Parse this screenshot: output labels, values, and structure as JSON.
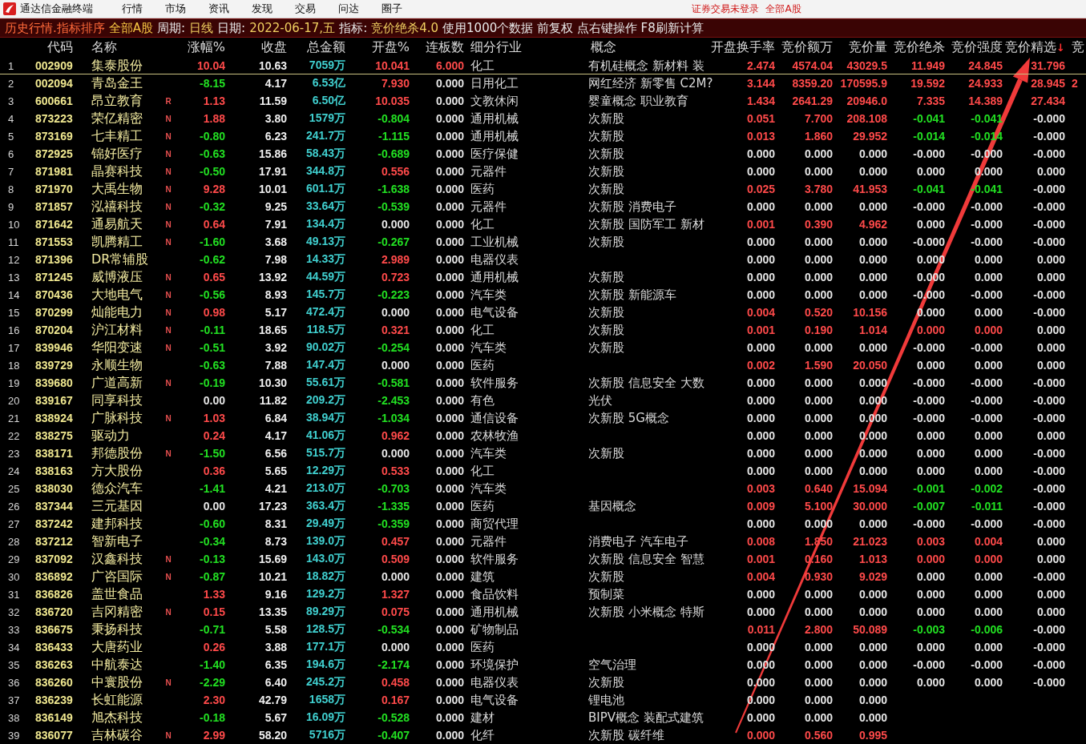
{
  "window": {
    "title": "通达信金融终端"
  },
  "menu": [
    "行情",
    "市场",
    "资讯",
    "发现",
    "交易",
    "问达",
    "圈子"
  ],
  "status": [
    "证券交易未登录",
    "全部A股"
  ],
  "info_bar": [
    {
      "kind": "title",
      "text": "历史行情.指标排序"
    },
    {
      "kind": "market",
      "text": "全部A股"
    },
    {
      "kind": "label",
      "text": "周期:"
    },
    {
      "kind": "value",
      "text": "日线"
    },
    {
      "kind": "label",
      "text": "日期:"
    },
    {
      "kind": "value",
      "text": "2022-06-17,五"
    },
    {
      "kind": "label",
      "text": "指标:"
    },
    {
      "kind": "value",
      "text": "竞价绝杀4.0"
    },
    {
      "kind": "label",
      "text": "使用1000个数据 前复权 点右键操作 F8刷新计算"
    }
  ],
  "table": {
    "columns": [
      {
        "kind": "index"
      },
      {
        "kind": "code",
        "label": "代码"
      },
      {
        "kind": "name",
        "label": "名称"
      },
      {
        "kind": "flag"
      },
      {
        "kind": "signed",
        "label": "涨幅%"
      },
      {
        "kind": "price",
        "label": "收盘"
      },
      {
        "kind": "amount",
        "label": "总金额"
      },
      {
        "kind": "signed",
        "label": "开盘%"
      },
      {
        "kind": "signed",
        "label": "连板数"
      },
      {
        "kind": "industry",
        "label": "细分行业"
      },
      {
        "kind": "concept",
        "label": "概念"
      },
      {
        "kind": "signed",
        "label": "开盘换手率"
      },
      {
        "kind": "signed",
        "label": "竞价额万"
      },
      {
        "kind": "signed",
        "label": "竞价量"
      },
      {
        "kind": "signed",
        "label": "竞价绝杀"
      },
      {
        "kind": "signed",
        "label": "竞价强度"
      },
      {
        "kind": "signed",
        "label": "竞价精选",
        "sort_mark": "↓"
      },
      {
        "kind": "cut",
        "label": "竞"
      }
    ],
    "rows": [
      {
        "selected": true,
        "cells": [
          "1",
          "002909",
          "集泰股份",
          null,
          {
            "text": "10.04",
            "color": "#ff4a4a"
          },
          "10.63",
          "7059万",
          {
            "text": "10.041",
            "color": "#ff4a4a"
          },
          {
            "text": "6.000",
            "color": "#ff4a4a"
          },
          "化工",
          "有机硅概念 新材料 装",
          {
            "text": "2.474",
            "color": "#ff4a4a"
          },
          {
            "text": "4574.04",
            "color": "#ff4a4a"
          },
          {
            "text": "43029.5",
            "color": "#ff4a4a"
          },
          {
            "text": "11.949",
            "color": "#ff4a4a"
          },
          {
            "text": "24.845",
            "color": "#ff4a4a"
          },
          {
            "text": "31.796",
            "color": "#ff4a4a"
          }
        ]
      },
      {
        "selected": false,
        "cells": [
          "2",
          "002094",
          "青岛金王",
          null,
          {
            "text": "-8.15",
            "color": "#22e022"
          },
          "4.17",
          "6.53亿",
          {
            "text": "7.930",
            "color": "#ff4a4a"
          },
          {
            "text": "0.000",
            "color": "#e6e6e6"
          },
          "日用化工",
          "网红经济 新零售 C2M?",
          {
            "text": "3.144",
            "color": "#ff4a4a"
          },
          {
            "text": "8359.20",
            "color": "#ff4a4a"
          },
          {
            "text": "170595.9",
            "color": "#ff4a4a"
          },
          {
            "text": "19.592",
            "color": "#ff4a4a"
          },
          {
            "text": "24.933",
            "color": "#ff4a4a"
          },
          {
            "text": "28.945",
            "color": "#ff4a4a"
          },
          "2"
        ]
      },
      {
        "selected": false,
        "cells": [
          "3",
          "600661",
          "昂立教育",
          "R",
          {
            "text": "1.13",
            "color": "#ff4a4a"
          },
          "11.59",
          "6.50亿",
          {
            "text": "10.035",
            "color": "#ff4a4a"
          },
          {
            "text": "0.000",
            "color": "#e6e6e6"
          },
          "文教休闲",
          "婴童概念 职业教育",
          {
            "text": "1.434",
            "color": "#ff4a4a"
          },
          {
            "text": "2641.29",
            "color": "#ff4a4a"
          },
          {
            "text": "20946.0",
            "color": "#ff4a4a"
          },
          {
            "text": "7.335",
            "color": "#ff4a4a"
          },
          {
            "text": "14.389",
            "color": "#ff4a4a"
          },
          {
            "text": "27.434",
            "color": "#ff4a4a"
          }
        ]
      },
      {
        "selected": false,
        "cells": [
          "4",
          "873223",
          "荣亿精密",
          "N",
          {
            "text": "1.88",
            "color": "#ff4a4a"
          },
          "3.80",
          "1579万",
          {
            "text": "-0.804",
            "color": "#22e022"
          },
          {
            "text": "0.000",
            "color": "#e6e6e6"
          },
          "通用机械",
          "次新股",
          {
            "text": "0.051",
            "color": "#ff4a4a"
          },
          {
            "text": "7.700",
            "color": "#ff4a4a"
          },
          {
            "text": "208.108",
            "color": "#ff4a4a"
          },
          {
            "text": "-0.041",
            "color": "#22e022"
          },
          {
            "text": "-0.041",
            "color": "#22e022"
          },
          {
            "text": "-0.000",
            "color": "#e6e6e6"
          }
        ]
      },
      {
        "selected": false,
        "cells": [
          "5",
          "873169",
          "七丰精工",
          "N",
          {
            "text": "-0.80",
            "color": "#22e022"
          },
          "6.23",
          "241.7万",
          {
            "text": "-1.115",
            "color": "#22e022"
          },
          {
            "text": "0.000",
            "color": "#e6e6e6"
          },
          "通用机械",
          "次新股",
          {
            "text": "0.013",
            "color": "#ff4a4a"
          },
          {
            "text": "1.860",
            "color": "#ff4a4a"
          },
          {
            "text": "29.952",
            "color": "#ff4a4a"
          },
          {
            "text": "-0.014",
            "color": "#22e022"
          },
          {
            "text": "-0.014",
            "color": "#22e022"
          },
          {
            "text": "-0.000",
            "color": "#e6e6e6"
          }
        ]
      },
      {
        "selected": false,
        "cells": [
          "6",
          "872925",
          "锦好医疗",
          "N",
          {
            "text": "-0.63",
            "color": "#22e022"
          },
          "15.86",
          "58.43万",
          {
            "text": "-0.689",
            "color": "#22e022"
          },
          {
            "text": "0.000",
            "color": "#e6e6e6"
          },
          "医疗保健",
          "次新股",
          {
            "text": "0.000",
            "color": "#e6e6e6"
          },
          {
            "text": "0.000",
            "color": "#e6e6e6"
          },
          {
            "text": "0.000",
            "color": "#e6e6e6"
          },
          {
            "text": "-0.000",
            "color": "#e6e6e6"
          },
          {
            "text": "-0.000",
            "color": "#e6e6e6"
          },
          {
            "text": "-0.000",
            "color": "#e6e6e6"
          }
        ]
      },
      {
        "selected": false,
        "cells": [
          "7",
          "871981",
          "晶赛科技",
          "N",
          {
            "text": "-0.50",
            "color": "#22e022"
          },
          "17.91",
          "344.8万",
          {
            "text": "0.556",
            "color": "#ff4a4a"
          },
          {
            "text": "0.000",
            "color": "#e6e6e6"
          },
          "元器件",
          "次新股",
          {
            "text": "0.000",
            "color": "#e6e6e6"
          },
          {
            "text": "0.000",
            "color": "#e6e6e6"
          },
          {
            "text": "0.000",
            "color": "#e6e6e6"
          },
          {
            "text": "0.000",
            "color": "#e6e6e6"
          },
          {
            "text": "0.000",
            "color": "#e6e6e6"
          },
          {
            "text": "0.000",
            "color": "#e6e6e6"
          }
        ]
      },
      {
        "selected": false,
        "cells": [
          "8",
          "871970",
          "大禹生物",
          "N",
          {
            "text": "9.28",
            "color": "#ff4a4a"
          },
          "10.01",
          "601.1万",
          {
            "text": "-1.638",
            "color": "#22e022"
          },
          {
            "text": "0.000",
            "color": "#e6e6e6"
          },
          "医药",
          "次新股",
          {
            "text": "0.025",
            "color": "#ff4a4a"
          },
          {
            "text": "3.780",
            "color": "#ff4a4a"
          },
          {
            "text": "41.953",
            "color": "#ff4a4a"
          },
          {
            "text": "-0.041",
            "color": "#22e022"
          },
          {
            "text": "-0.041",
            "color": "#22e022"
          },
          {
            "text": "-0.000",
            "color": "#e6e6e6"
          }
        ]
      },
      {
        "selected": false,
        "cells": [
          "9",
          "871857",
          "泓禧科技",
          "N",
          {
            "text": "-0.32",
            "color": "#22e022"
          },
          "9.25",
          "33.64万",
          {
            "text": "-0.539",
            "color": "#22e022"
          },
          {
            "text": "0.000",
            "color": "#e6e6e6"
          },
          "元器件",
          "次新股 消费电子",
          {
            "text": "0.000",
            "color": "#e6e6e6"
          },
          {
            "text": "0.000",
            "color": "#e6e6e6"
          },
          {
            "text": "0.000",
            "color": "#e6e6e6"
          },
          {
            "text": "-0.000",
            "color": "#e6e6e6"
          },
          {
            "text": "-0.000",
            "color": "#e6e6e6"
          },
          {
            "text": "-0.000",
            "color": "#e6e6e6"
          }
        ]
      },
      {
        "selected": false,
        "cells": [
          "10",
          "871642",
          "通易航天",
          "N",
          {
            "text": "0.64",
            "color": "#ff4a4a"
          },
          "7.91",
          "134.4万",
          {
            "text": "0.000",
            "color": "#e6e6e6"
          },
          {
            "text": "0.000",
            "color": "#e6e6e6"
          },
          "化工",
          "次新股 国防军工 新材",
          {
            "text": "0.001",
            "color": "#ff4a4a"
          },
          {
            "text": "0.390",
            "color": "#ff4a4a"
          },
          {
            "text": "4.962",
            "color": "#ff4a4a"
          },
          {
            "text": "0.000",
            "color": "#e6e6e6"
          },
          {
            "text": "-0.000",
            "color": "#e6e6e6"
          },
          {
            "text": "-0.000",
            "color": "#e6e6e6"
          }
        ]
      },
      {
        "selected": false,
        "cells": [
          "11",
          "871553",
          "凯腾精工",
          "N",
          {
            "text": "-1.60",
            "color": "#22e022"
          },
          "3.68",
          "49.13万",
          {
            "text": "-0.267",
            "color": "#22e022"
          },
          {
            "text": "0.000",
            "color": "#e6e6e6"
          },
          "工业机械",
          "次新股",
          {
            "text": "0.000",
            "color": "#e6e6e6"
          },
          {
            "text": "0.000",
            "color": "#e6e6e6"
          },
          {
            "text": "0.000",
            "color": "#e6e6e6"
          },
          {
            "text": "-0.000",
            "color": "#e6e6e6"
          },
          {
            "text": "-0.000",
            "color": "#e6e6e6"
          },
          {
            "text": "-0.000",
            "color": "#e6e6e6"
          }
        ]
      },
      {
        "selected": false,
        "cells": [
          "12",
          "871396",
          "DR常辅股",
          null,
          {
            "text": "-0.62",
            "color": "#22e022"
          },
          "7.98",
          "14.33万",
          {
            "text": "2.989",
            "color": "#ff4a4a"
          },
          {
            "text": "0.000",
            "color": "#e6e6e6"
          },
          "电器仪表",
          null,
          {
            "text": "0.000",
            "color": "#e6e6e6"
          },
          {
            "text": "0.000",
            "color": "#e6e6e6"
          },
          {
            "text": "0.000",
            "color": "#e6e6e6"
          },
          {
            "text": "0.000",
            "color": "#e6e6e6"
          },
          {
            "text": "0.000",
            "color": "#e6e6e6"
          },
          {
            "text": "0.000",
            "color": "#e6e6e6"
          }
        ]
      },
      {
        "selected": false,
        "cells": [
          "13",
          "871245",
          "威博液压",
          "N",
          {
            "text": "0.65",
            "color": "#ff4a4a"
          },
          "13.92",
          "44.59万",
          {
            "text": "0.723",
            "color": "#ff4a4a"
          },
          {
            "text": "0.000",
            "color": "#e6e6e6"
          },
          "通用机械",
          "次新股",
          {
            "text": "0.000",
            "color": "#e6e6e6"
          },
          {
            "text": "0.000",
            "color": "#e6e6e6"
          },
          {
            "text": "0.000",
            "color": "#e6e6e6"
          },
          {
            "text": "0.000",
            "color": "#e6e6e6"
          },
          {
            "text": "0.000",
            "color": "#e6e6e6"
          },
          {
            "text": "0.000",
            "color": "#e6e6e6"
          }
        ]
      },
      {
        "selected": false,
        "cells": [
          "14",
          "870436",
          "大地电气",
          "N",
          {
            "text": "-0.56",
            "color": "#22e022"
          },
          "8.93",
          "145.7万",
          {
            "text": "-0.223",
            "color": "#22e022"
          },
          {
            "text": "0.000",
            "color": "#e6e6e6"
          },
          "汽车类",
          "次新股 新能源车",
          {
            "text": "0.000",
            "color": "#e6e6e6"
          },
          {
            "text": "0.000",
            "color": "#e6e6e6"
          },
          {
            "text": "0.000",
            "color": "#e6e6e6"
          },
          {
            "text": "-0.000",
            "color": "#e6e6e6"
          },
          {
            "text": "-0.000",
            "color": "#e6e6e6"
          },
          {
            "text": "-0.000",
            "color": "#e6e6e6"
          }
        ]
      },
      {
        "selected": false,
        "cells": [
          "15",
          "870299",
          "灿能电力",
          "N",
          {
            "text": "0.98",
            "color": "#ff4a4a"
          },
          "5.17",
          "472.4万",
          {
            "text": "0.000",
            "color": "#e6e6e6"
          },
          {
            "text": "0.000",
            "color": "#e6e6e6"
          },
          "电气设备",
          "次新股",
          {
            "text": "0.004",
            "color": "#ff4a4a"
          },
          {
            "text": "0.520",
            "color": "#ff4a4a"
          },
          {
            "text": "10.156",
            "color": "#ff4a4a"
          },
          {
            "text": "0.000",
            "color": "#e6e6e6"
          },
          {
            "text": "0.000",
            "color": "#e6e6e6"
          },
          {
            "text": "-0.000",
            "color": "#e6e6e6"
          }
        ]
      },
      {
        "selected": false,
        "cells": [
          "16",
          "870204",
          "沪江材料",
          "N",
          {
            "text": "-0.11",
            "color": "#22e022"
          },
          "18.65",
          "118.5万",
          {
            "text": "0.321",
            "color": "#ff4a4a"
          },
          {
            "text": "0.000",
            "color": "#e6e6e6"
          },
          "化工",
          "次新股",
          {
            "text": "0.001",
            "color": "#ff4a4a"
          },
          {
            "text": "0.190",
            "color": "#ff4a4a"
          },
          {
            "text": "1.014",
            "color": "#ff4a4a"
          },
          {
            "text": "0.000",
            "color": "#ff4a4a"
          },
          {
            "text": "0.000",
            "color": "#ff4a4a"
          },
          {
            "text": "0.000",
            "color": "#e6e6e6"
          }
        ]
      },
      {
        "selected": false,
        "cells": [
          "17",
          "839946",
          "华阳变速",
          "N",
          {
            "text": "-0.51",
            "color": "#22e022"
          },
          "3.92",
          "90.02万",
          {
            "text": "-0.254",
            "color": "#22e022"
          },
          {
            "text": "0.000",
            "color": "#e6e6e6"
          },
          "汽车类",
          "次新股",
          {
            "text": "0.000",
            "color": "#e6e6e6"
          },
          {
            "text": "0.000",
            "color": "#e6e6e6"
          },
          {
            "text": "0.000",
            "color": "#e6e6e6"
          },
          {
            "text": "-0.000",
            "color": "#e6e6e6"
          },
          {
            "text": "-0.000",
            "color": "#e6e6e6"
          },
          {
            "text": "0.000",
            "color": "#e6e6e6"
          }
        ]
      },
      {
        "selected": false,
        "cells": [
          "18",
          "839729",
          "永顺生物",
          null,
          {
            "text": "-0.63",
            "color": "#22e022"
          },
          "7.88",
          "147.4万",
          {
            "text": "0.000",
            "color": "#e6e6e6"
          },
          {
            "text": "0.000",
            "color": "#e6e6e6"
          },
          "医药",
          null,
          {
            "text": "0.002",
            "color": "#ff4a4a"
          },
          {
            "text": "1.590",
            "color": "#ff4a4a"
          },
          {
            "text": "20.050",
            "color": "#ff4a4a"
          },
          {
            "text": "0.000",
            "color": "#e6e6e6"
          },
          {
            "text": "0.000",
            "color": "#e6e6e6"
          },
          {
            "text": "0.000",
            "color": "#e6e6e6"
          }
        ]
      },
      {
        "selected": false,
        "cells": [
          "19",
          "839680",
          "广道高新",
          "N",
          {
            "text": "-0.19",
            "color": "#22e022"
          },
          "10.30",
          "55.61万",
          {
            "text": "-0.581",
            "color": "#22e022"
          },
          {
            "text": "0.000",
            "color": "#e6e6e6"
          },
          "软件服务",
          "次新股 信息安全 大数",
          {
            "text": "0.000",
            "color": "#e6e6e6"
          },
          {
            "text": "0.000",
            "color": "#e6e6e6"
          },
          {
            "text": "0.000",
            "color": "#e6e6e6"
          },
          {
            "text": "-0.000",
            "color": "#e6e6e6"
          },
          {
            "text": "-0.000",
            "color": "#e6e6e6"
          },
          {
            "text": "-0.000",
            "color": "#e6e6e6"
          }
        ]
      },
      {
        "selected": false,
        "cells": [
          "20",
          "839167",
          "同享科技",
          null,
          {
            "text": "0.00",
            "color": "#e6e6e6"
          },
          "11.82",
          "209.2万",
          {
            "text": "-2.453",
            "color": "#22e022"
          },
          {
            "text": "0.000",
            "color": "#e6e6e6"
          },
          "有色",
          "光伏",
          {
            "text": "0.000",
            "color": "#e6e6e6"
          },
          {
            "text": "0.000",
            "color": "#e6e6e6"
          },
          {
            "text": "0.000",
            "color": "#e6e6e6"
          },
          {
            "text": "-0.000",
            "color": "#e6e6e6"
          },
          {
            "text": "-0.000",
            "color": "#e6e6e6"
          },
          {
            "text": "-0.000",
            "color": "#e6e6e6"
          }
        ]
      },
      {
        "selected": false,
        "cells": [
          "21",
          "838924",
          "广脉科技",
          "N",
          {
            "text": "1.03",
            "color": "#ff4a4a"
          },
          "6.84",
          "38.94万",
          {
            "text": "-1.034",
            "color": "#22e022"
          },
          {
            "text": "0.000",
            "color": "#e6e6e6"
          },
          "通信设备",
          "次新股 5G概念",
          {
            "text": "0.000",
            "color": "#e6e6e6"
          },
          {
            "text": "0.000",
            "color": "#e6e6e6"
          },
          {
            "text": "0.000",
            "color": "#e6e6e6"
          },
          {
            "text": "-0.000",
            "color": "#e6e6e6"
          },
          {
            "text": "-0.000",
            "color": "#e6e6e6"
          },
          {
            "text": "-0.000",
            "color": "#e6e6e6"
          }
        ]
      },
      {
        "selected": false,
        "cells": [
          "22",
          "838275",
          "驱动力",
          null,
          {
            "text": "0.24",
            "color": "#ff4a4a"
          },
          "4.17",
          "41.06万",
          {
            "text": "0.962",
            "color": "#ff4a4a"
          },
          {
            "text": "0.000",
            "color": "#e6e6e6"
          },
          "农林牧渔",
          null,
          {
            "text": "0.000",
            "color": "#e6e6e6"
          },
          {
            "text": "0.000",
            "color": "#e6e6e6"
          },
          {
            "text": "0.000",
            "color": "#e6e6e6"
          },
          {
            "text": "0.000",
            "color": "#e6e6e6"
          },
          {
            "text": "0.000",
            "color": "#e6e6e6"
          },
          {
            "text": "0.000",
            "color": "#e6e6e6"
          }
        ]
      },
      {
        "selected": false,
        "cells": [
          "23",
          "838171",
          "邦德股份",
          "N",
          {
            "text": "-1.50",
            "color": "#22e022"
          },
          "6.56",
          "515.7万",
          {
            "text": "0.000",
            "color": "#e6e6e6"
          },
          {
            "text": "0.000",
            "color": "#e6e6e6"
          },
          "汽车类",
          "次新股",
          {
            "text": "0.000",
            "color": "#e6e6e6"
          },
          {
            "text": "0.000",
            "color": "#e6e6e6"
          },
          {
            "text": "0.000",
            "color": "#e6e6e6"
          },
          {
            "text": "0.000",
            "color": "#e6e6e6"
          },
          {
            "text": "0.000",
            "color": "#e6e6e6"
          },
          {
            "text": "-0.000",
            "color": "#e6e6e6"
          }
        ]
      },
      {
        "selected": false,
        "cells": [
          "24",
          "838163",
          "方大股份",
          null,
          {
            "text": "0.36",
            "color": "#ff4a4a"
          },
          "5.65",
          "12.29万",
          {
            "text": "0.533",
            "color": "#ff4a4a"
          },
          {
            "text": "0.000",
            "color": "#e6e6e6"
          },
          "化工",
          null,
          {
            "text": "0.000",
            "color": "#e6e6e6"
          },
          {
            "text": "0.000",
            "color": "#e6e6e6"
          },
          {
            "text": "0.000",
            "color": "#e6e6e6"
          },
          {
            "text": "0.000",
            "color": "#e6e6e6"
          },
          {
            "text": "0.000",
            "color": "#e6e6e6"
          },
          {
            "text": "-0.000",
            "color": "#e6e6e6"
          }
        ]
      },
      {
        "selected": false,
        "cells": [
          "25",
          "838030",
          "德众汽车",
          null,
          {
            "text": "-1.41",
            "color": "#22e022"
          },
          "4.21",
          "213.0万",
          {
            "text": "-0.703",
            "color": "#22e022"
          },
          {
            "text": "0.000",
            "color": "#e6e6e6"
          },
          "汽车类",
          null,
          {
            "text": "0.003",
            "color": "#ff4a4a"
          },
          {
            "text": "0.640",
            "color": "#ff4a4a"
          },
          {
            "text": "15.094",
            "color": "#ff4a4a"
          },
          {
            "text": "-0.001",
            "color": "#22e022"
          },
          {
            "text": "-0.002",
            "color": "#22e022"
          },
          {
            "text": "-0.000",
            "color": "#e6e6e6"
          }
        ]
      },
      {
        "selected": false,
        "cells": [
          "26",
          "837344",
          "三元基因",
          null,
          {
            "text": "0.00",
            "color": "#e6e6e6"
          },
          "17.23",
          "363.4万",
          {
            "text": "-1.335",
            "color": "#22e022"
          },
          {
            "text": "0.000",
            "color": "#e6e6e6"
          },
          "医药",
          "基因概念",
          {
            "text": "0.009",
            "color": "#ff4a4a"
          },
          {
            "text": "5.100",
            "color": "#ff4a4a"
          },
          {
            "text": "30.000",
            "color": "#ff4a4a"
          },
          {
            "text": "-0.007",
            "color": "#22e022"
          },
          {
            "text": "-0.011",
            "color": "#22e022"
          },
          {
            "text": "-0.000",
            "color": "#e6e6e6"
          }
        ]
      },
      {
        "selected": false,
        "cells": [
          "27",
          "837242",
          "建邦科技",
          null,
          {
            "text": "-0.60",
            "color": "#22e022"
          },
          "8.31",
          "29.49万",
          {
            "text": "-0.359",
            "color": "#22e022"
          },
          {
            "text": "0.000",
            "color": "#e6e6e6"
          },
          "商贸代理",
          null,
          {
            "text": "0.000",
            "color": "#e6e6e6"
          },
          {
            "text": "0.000",
            "color": "#e6e6e6"
          },
          {
            "text": "0.000",
            "color": "#e6e6e6"
          },
          {
            "text": "-0.000",
            "color": "#e6e6e6"
          },
          {
            "text": "-0.000",
            "color": "#e6e6e6"
          },
          {
            "text": "-0.000",
            "color": "#e6e6e6"
          }
        ]
      },
      {
        "selected": false,
        "cells": [
          "28",
          "837212",
          "智新电子",
          null,
          {
            "text": "-0.34",
            "color": "#22e022"
          },
          "8.73",
          "139.0万",
          {
            "text": "0.457",
            "color": "#ff4a4a"
          },
          {
            "text": "0.000",
            "color": "#e6e6e6"
          },
          "元器件",
          "消费电子 汽车电子",
          {
            "text": "0.008",
            "color": "#ff4a4a"
          },
          {
            "text": "1.850",
            "color": "#ff4a4a"
          },
          {
            "text": "21.023",
            "color": "#ff4a4a"
          },
          {
            "text": "0.003",
            "color": "#ff4a4a"
          },
          {
            "text": "0.004",
            "color": "#ff4a4a"
          },
          {
            "text": "0.000",
            "color": "#e6e6e6"
          }
        ]
      },
      {
        "selected": false,
        "cells": [
          "29",
          "837092",
          "汉鑫科技",
          "N",
          {
            "text": "-0.13",
            "color": "#22e022"
          },
          "15.69",
          "143.0万",
          {
            "text": "0.509",
            "color": "#ff4a4a"
          },
          {
            "text": "0.000",
            "color": "#e6e6e6"
          },
          "软件服务",
          "次新股 信息安全 智慧",
          {
            "text": "0.001",
            "color": "#ff4a4a"
          },
          {
            "text": "0.160",
            "color": "#ff4a4a"
          },
          {
            "text": "1.013",
            "color": "#ff4a4a"
          },
          {
            "text": "0.000",
            "color": "#ff4a4a"
          },
          {
            "text": "0.000",
            "color": "#ff4a4a"
          },
          {
            "text": "0.000",
            "color": "#e6e6e6"
          }
        ]
      },
      {
        "selected": false,
        "cells": [
          "30",
          "836892",
          "广咨国际",
          "N",
          {
            "text": "-0.87",
            "color": "#22e022"
          },
          "10.21",
          "18.82万",
          {
            "text": "0.000",
            "color": "#e6e6e6"
          },
          {
            "text": "0.000",
            "color": "#e6e6e6"
          },
          "建筑",
          "次新股",
          {
            "text": "0.004",
            "color": "#ff4a4a"
          },
          {
            "text": "0.930",
            "color": "#ff4a4a"
          },
          {
            "text": "9.029",
            "color": "#ff4a4a"
          },
          {
            "text": "0.000",
            "color": "#e6e6e6"
          },
          {
            "text": "0.000",
            "color": "#e6e6e6"
          },
          {
            "text": "-0.000",
            "color": "#e6e6e6"
          }
        ]
      },
      {
        "selected": false,
        "cells": [
          "31",
          "836826",
          "盖世食品",
          null,
          {
            "text": "1.33",
            "color": "#ff4a4a"
          },
          "9.16",
          "129.2万",
          {
            "text": "1.327",
            "color": "#ff4a4a"
          },
          {
            "text": "0.000",
            "color": "#e6e6e6"
          },
          "食品饮料",
          "预制菜",
          {
            "text": "0.000",
            "color": "#e6e6e6"
          },
          {
            "text": "0.000",
            "color": "#e6e6e6"
          },
          {
            "text": "0.000",
            "color": "#e6e6e6"
          },
          {
            "text": "0.000",
            "color": "#e6e6e6"
          },
          {
            "text": "0.000",
            "color": "#e6e6e6"
          },
          {
            "text": "0.000",
            "color": "#e6e6e6"
          }
        ]
      },
      {
        "selected": false,
        "cells": [
          "32",
          "836720",
          "吉冈精密",
          "N",
          {
            "text": "0.15",
            "color": "#ff4a4a"
          },
          "13.35",
          "89.29万",
          {
            "text": "0.075",
            "color": "#ff4a4a"
          },
          {
            "text": "0.000",
            "color": "#e6e6e6"
          },
          "通用机械",
          "次新股 小米概念 特斯",
          {
            "text": "0.000",
            "color": "#e6e6e6"
          },
          {
            "text": "0.000",
            "color": "#e6e6e6"
          },
          {
            "text": "0.000",
            "color": "#e6e6e6"
          },
          {
            "text": "0.000",
            "color": "#e6e6e6"
          },
          {
            "text": "0.000",
            "color": "#e6e6e6"
          },
          {
            "text": "0.000",
            "color": "#e6e6e6"
          }
        ]
      },
      {
        "selected": false,
        "cells": [
          "33",
          "836675",
          "秉扬科技",
          null,
          {
            "text": "-0.71",
            "color": "#22e022"
          },
          "5.58",
          "128.5万",
          {
            "text": "-0.534",
            "color": "#22e022"
          },
          {
            "text": "0.000",
            "color": "#e6e6e6"
          },
          "矿物制品",
          null,
          {
            "text": "0.011",
            "color": "#ff4a4a"
          },
          {
            "text": "2.800",
            "color": "#ff4a4a"
          },
          {
            "text": "50.089",
            "color": "#ff4a4a"
          },
          {
            "text": "-0.003",
            "color": "#22e022"
          },
          {
            "text": "-0.006",
            "color": "#22e022"
          },
          {
            "text": "-0.000",
            "color": "#e6e6e6"
          }
        ]
      },
      {
        "selected": false,
        "cells": [
          "34",
          "836433",
          "大唐药业",
          null,
          {
            "text": "0.26",
            "color": "#ff4a4a"
          },
          "3.88",
          "177.1万",
          {
            "text": "0.000",
            "color": "#e6e6e6"
          },
          {
            "text": "0.000",
            "color": "#e6e6e6"
          },
          "医药",
          null,
          {
            "text": "0.000",
            "color": "#e6e6e6"
          },
          {
            "text": "0.000",
            "color": "#e6e6e6"
          },
          {
            "text": "0.000",
            "color": "#e6e6e6"
          },
          {
            "text": "0.000",
            "color": "#e6e6e6"
          },
          {
            "text": "0.000",
            "color": "#e6e6e6"
          },
          {
            "text": "-0.000",
            "color": "#e6e6e6"
          }
        ]
      },
      {
        "selected": false,
        "cells": [
          "35",
          "836263",
          "中航泰达",
          null,
          {
            "text": "-1.40",
            "color": "#22e022"
          },
          "6.35",
          "194.6万",
          {
            "text": "-2.174",
            "color": "#22e022"
          },
          {
            "text": "0.000",
            "color": "#e6e6e6"
          },
          "环境保护",
          "空气治理",
          {
            "text": "0.000",
            "color": "#e6e6e6"
          },
          {
            "text": "0.000",
            "color": "#e6e6e6"
          },
          {
            "text": "0.000",
            "color": "#e6e6e6"
          },
          {
            "text": "-0.000",
            "color": "#e6e6e6"
          },
          {
            "text": "-0.000",
            "color": "#e6e6e6"
          },
          {
            "text": "-0.000",
            "color": "#e6e6e6"
          }
        ]
      },
      {
        "selected": false,
        "cells": [
          "36",
          "836260",
          "中寰股份",
          "N",
          {
            "text": "-2.29",
            "color": "#22e022"
          },
          "6.40",
          "245.2万",
          {
            "text": "0.458",
            "color": "#ff4a4a"
          },
          {
            "text": "0.000",
            "color": "#e6e6e6"
          },
          "电器仪表",
          "次新股",
          {
            "text": "0.000",
            "color": "#e6e6e6"
          },
          {
            "text": "0.000",
            "color": "#e6e6e6"
          },
          {
            "text": "0.000",
            "color": "#e6e6e6"
          },
          {
            "text": "0.000",
            "color": "#e6e6e6"
          },
          {
            "text": "0.000",
            "color": "#e6e6e6"
          },
          {
            "text": "-0.000",
            "color": "#e6e6e6"
          }
        ]
      },
      {
        "selected": false,
        "cells": [
          "37",
          "836239",
          "长虹能源",
          null,
          {
            "text": "2.30",
            "color": "#ff4a4a"
          },
          "42.79",
          "1658万",
          {
            "text": "0.167",
            "color": "#ff4a4a"
          },
          {
            "text": "0.000",
            "color": "#e6e6e6"
          },
          "电气设备",
          "锂电池",
          {
            "text": "0.000",
            "color": "#e6e6e6"
          },
          {
            "text": "0.000",
            "color": "#e6e6e6"
          },
          {
            "text": "0.000",
            "color": "#e6e6e6"
          }
        ]
      },
      {
        "selected": false,
        "cells": [
          "38",
          "836149",
          "旭杰科技",
          null,
          {
            "text": "-0.18",
            "color": "#22e022"
          },
          "5.67",
          "16.09万",
          {
            "text": "-0.528",
            "color": "#22e022"
          },
          {
            "text": "0.000",
            "color": "#e6e6e6"
          },
          "建材",
          "BIPV概念 装配式建筑",
          {
            "text": "0.000",
            "color": "#e6e6e6"
          },
          {
            "text": "0.000",
            "color": "#e6e6e6"
          },
          {
            "text": "0.000",
            "color": "#e6e6e6"
          }
        ]
      },
      {
        "selected": false,
        "cells": [
          "39",
          "836077",
          "吉林碳谷",
          "N",
          {
            "text": "2.99",
            "color": "#ff4a4a"
          },
          "58.20",
          "5716万",
          {
            "text": "-0.407",
            "color": "#22e022"
          },
          {
            "text": "0.000",
            "color": "#e6e6e6"
          },
          "化纤",
          "次新股 碳纤维",
          {
            "text": "0.000",
            "color": "#ff4a4a"
          },
          {
            "text": "0.560",
            "color": "#ff4a4a"
          },
          {
            "text": "0.995",
            "color": "#ff4a4a"
          }
        ]
      }
    ]
  }
}
